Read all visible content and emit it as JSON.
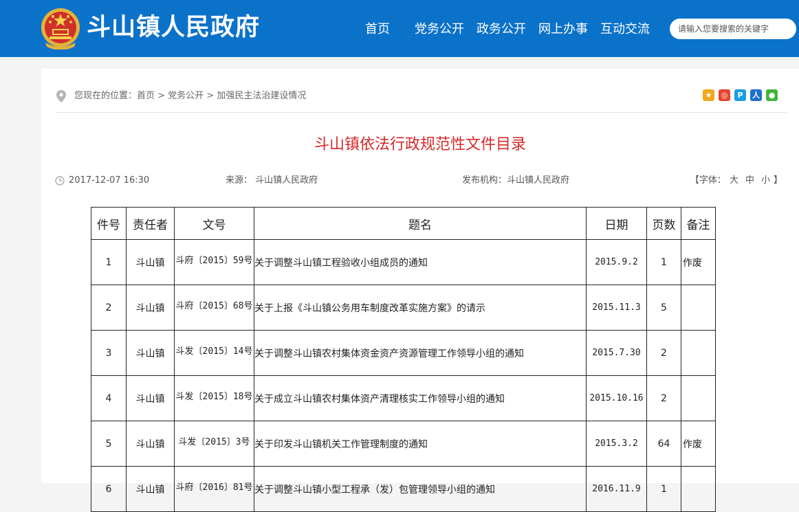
{
  "header": {
    "site_title": "斗山镇人民政府",
    "nav": [
      {
        "label": "首页"
      },
      {
        "label": "党务公开"
      },
      {
        "label": "政务公开"
      },
      {
        "label": "网上办事"
      },
      {
        "label": "互动交流"
      }
    ],
    "search_placeholder": "请输入您要搜索的关键字"
  },
  "breadcrumb": {
    "text": "您现在的位置：首页 > 党务公开 > 加强民主法治建设情况"
  },
  "share_icons": [
    "qzone-icon",
    "weibo-icon",
    "tencent-weibo-icon",
    "renren-icon",
    "wechat-icon"
  ],
  "article": {
    "title": "斗山镇依法行政规范性文件目录",
    "date": "2017-12-07 16:30",
    "source": "来源： 斗山镇人民政府",
    "org": "发布机构：斗山镇人民政府",
    "font_label": "【字体：",
    "font_sizes": [
      "大",
      "中",
      "小"
    ],
    "font_end": "】"
  },
  "table": {
    "headers": [
      "件号",
      "责任者",
      "文号",
      "题名",
      "日期",
      "页数",
      "备注"
    ],
    "rows": [
      {
        "no": "1",
        "owner": "斗山镇",
        "docno": "斗府〔2015〕59号",
        "title": "关于调整斗山镇工程验收小组成员的通知",
        "date": "2015.9.2",
        "pages": "1",
        "note": "作废"
      },
      {
        "no": "2",
        "owner": "斗山镇",
        "docno": "斗府〔2015〕68号",
        "title": "关于上报《斗山镇公务用车制度改革实施方案》的请示",
        "date": "2015.11.3",
        "pages": "5",
        "note": ""
      },
      {
        "no": "3",
        "owner": "斗山镇",
        "docno": "斗发〔2015〕14号",
        "title": "关于调整斗山镇农村集体资金资产资源管理工作领导小组的通知",
        "date": "2015.7.30",
        "pages": "2",
        "note": ""
      },
      {
        "no": "4",
        "owner": "斗山镇",
        "docno": "斗发〔2015〕18号",
        "title": "关于成立斗山镇农村集体资产清理核实工作领导小组的通知",
        "date": "2015.10.16",
        "pages": "2",
        "note": ""
      },
      {
        "no": "5",
        "owner": "斗山镇",
        "docno": "斗发〔2015〕3号",
        "title": "关于印发斗山镇机关工作管理制度的通知",
        "date": "2015.3.2",
        "pages": "64",
        "note": "作废"
      },
      {
        "no": "6",
        "owner": "斗山镇",
        "docno": "斗府〔2016〕81号",
        "title": "关于调整斗山镇小型工程承（发）包管理领导小组的通知",
        "date": "2016.11.9",
        "pages": "1",
        "note": ""
      }
    ]
  }
}
